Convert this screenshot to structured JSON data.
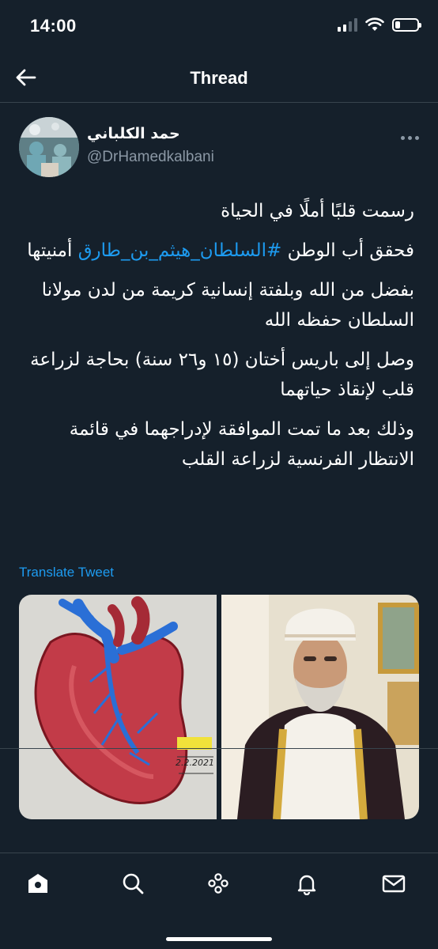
{
  "status_bar": {
    "time": "14:00"
  },
  "nav": {
    "title": "Thread"
  },
  "tweet": {
    "author": {
      "name": "حمد الكلباني",
      "handle": "@DrHamedkalbani"
    },
    "paragraphs": [
      {
        "text": "رسمت قلبًا أملًا في الحياة"
      },
      {
        "before": "فحقق أب الوطن ",
        "hashtag": "#السلطان_هيثم_بن_طارق",
        "after": " أمنيتها"
      },
      {
        "text": "بفضل من الله وبلفتة إنسانية كريمة من لدن مولانا السلطان حفظه الله"
      },
      {
        "text": "وصل إلى باريس أختان (١٥ و٢٦ سنة) بحاجة لزراعة قلب لإنقاذ حياتهما"
      },
      {
        "text": "وذلك بعد ما تمت الموافقة لإدراجهما في قائمة الانتظار الفرنسية لزراعة القلب"
      }
    ],
    "translate_label": "Translate Tweet",
    "media": {
      "heart_drawing_date": "2.2.2021"
    }
  },
  "tab_bar": {
    "tabs": [
      "home-icon",
      "search-icon",
      "spaces-icon",
      "notifications-icon",
      "messages-icon"
    ]
  },
  "colors": {
    "background": "#15202b",
    "accent": "#1d9bf0",
    "secondary_text": "#8b98a5",
    "divider": "#38444d"
  }
}
